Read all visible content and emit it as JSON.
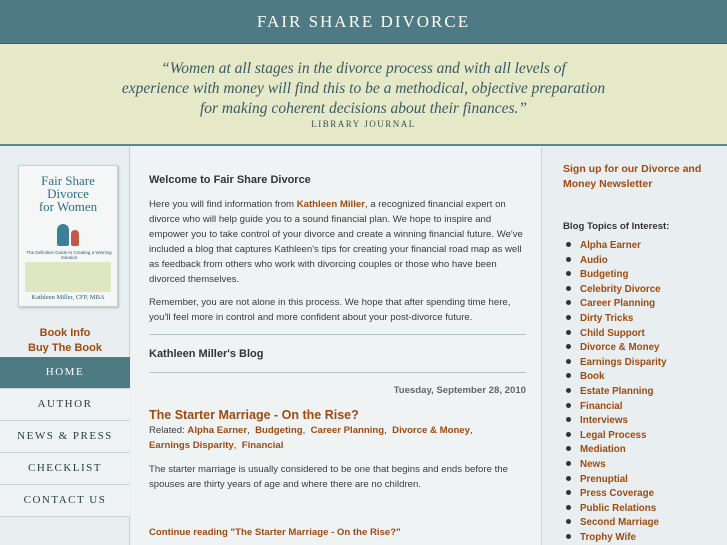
{
  "header": {
    "title": "FAIR SHARE DIVORCE"
  },
  "quote": {
    "lines": [
      "“Women at all stages in the divorce process and with all levels of",
      "experience with money will find this to be a methodical, objective preparation",
      "for making coherent decisions about their finances.”"
    ],
    "source": "LIBRARY JOURNAL"
  },
  "book": {
    "cover_title": [
      "Fair Share",
      "Divorce",
      "for Women"
    ],
    "cover_subtitle": "The Definitive Guide to Creating a Winning Solution",
    "cover_author": "Kathleen Miller, CFP, MBA",
    "info_link": "Book Info",
    "buy_link": "Buy The Book"
  },
  "nav": {
    "items": [
      "HOME",
      "AUTHOR",
      "NEWS & PRESS",
      "CHECKLIST",
      "CONTACT US"
    ],
    "active": "HOME"
  },
  "main": {
    "welcome_heading": "Welcome to Fair Share Divorce",
    "intro_part1": "Here you will find information from ",
    "intro_name": "Kathleen Miller",
    "intro_part2": ", a recognized financial expert on divorce who will help guide you to a sound financial plan. We hope to inspire and empower you to take control of your divorce and create a winning financial future. We've included a blog that captures Kathleen's tips for creating your financial road map as well as feedback from others who work with divorcing couples or those who have been divorced themselves.",
    "intro_para2": "Remember, you are not alone in this process. We hope that after spending time here, you'll feel more in control and more confident about your post-divorce future.",
    "blog_heading": "Kathleen Miller's Blog",
    "post_date": "Tuesday, September 28, 2010",
    "post_title": "The Starter Marriage - On the Rise?",
    "related_label": "Related:",
    "related_tags": [
      "Alpha Earner",
      "Budgeting",
      "Career Planning",
      "Divorce & Money",
      "Earnings Disparity",
      "Financial"
    ],
    "post_excerpt": "The starter marriage is usually considered to be one that begins and ends before the spouses are thirty years of age and where there are no children.",
    "continue_link": "Continue reading \"The Starter Marriage - On the Rise?\""
  },
  "sidebar": {
    "signup_text": "Sign up for our Divorce and Money Newsletter",
    "topics_heading": "Blog Topics of Interest:",
    "topics": [
      "Alpha Earner",
      "Audio",
      "Budgeting",
      "Celebrity Divorce",
      "Career Planning",
      "Dirty Tricks",
      "Child Support",
      "Divorce & Money",
      "Earnings Disparity",
      "Book",
      "Estate Planning",
      "Financial",
      "Interviews",
      "Legal Process",
      "Mediation",
      "News",
      "Prenuptial",
      "Press Coverage",
      "Public Relations",
      "Second Marriage",
      "Trophy Wife"
    ]
  },
  "colors": {
    "header_bg": "#4e7a84",
    "quote_bg": "#e6e9c8",
    "link": "#a04a10",
    "page_bg": "#e9eff0"
  }
}
